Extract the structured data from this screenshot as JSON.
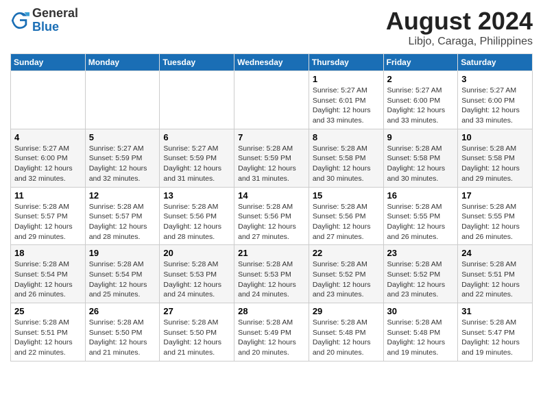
{
  "header": {
    "logo": {
      "general": "General",
      "blue": "Blue"
    },
    "title": "August 2024",
    "subtitle": "Libjo, Caraga, Philippines"
  },
  "calendar": {
    "days_of_week": [
      "Sunday",
      "Monday",
      "Tuesday",
      "Wednesday",
      "Thursday",
      "Friday",
      "Saturday"
    ],
    "weeks": [
      {
        "days": [
          {
            "number": "",
            "info": ""
          },
          {
            "number": "",
            "info": ""
          },
          {
            "number": "",
            "info": ""
          },
          {
            "number": "",
            "info": ""
          },
          {
            "number": "1",
            "info": "Sunrise: 5:27 AM\nSunset: 6:01 PM\nDaylight: 12 hours\nand 33 minutes."
          },
          {
            "number": "2",
            "info": "Sunrise: 5:27 AM\nSunset: 6:00 PM\nDaylight: 12 hours\nand 33 minutes."
          },
          {
            "number": "3",
            "info": "Sunrise: 5:27 AM\nSunset: 6:00 PM\nDaylight: 12 hours\nand 33 minutes."
          }
        ]
      },
      {
        "days": [
          {
            "number": "4",
            "info": "Sunrise: 5:27 AM\nSunset: 6:00 PM\nDaylight: 12 hours\nand 32 minutes."
          },
          {
            "number": "5",
            "info": "Sunrise: 5:27 AM\nSunset: 5:59 PM\nDaylight: 12 hours\nand 32 minutes."
          },
          {
            "number": "6",
            "info": "Sunrise: 5:27 AM\nSunset: 5:59 PM\nDaylight: 12 hours\nand 31 minutes."
          },
          {
            "number": "7",
            "info": "Sunrise: 5:28 AM\nSunset: 5:59 PM\nDaylight: 12 hours\nand 31 minutes."
          },
          {
            "number": "8",
            "info": "Sunrise: 5:28 AM\nSunset: 5:58 PM\nDaylight: 12 hours\nand 30 minutes."
          },
          {
            "number": "9",
            "info": "Sunrise: 5:28 AM\nSunset: 5:58 PM\nDaylight: 12 hours\nand 30 minutes."
          },
          {
            "number": "10",
            "info": "Sunrise: 5:28 AM\nSunset: 5:58 PM\nDaylight: 12 hours\nand 29 minutes."
          }
        ]
      },
      {
        "days": [
          {
            "number": "11",
            "info": "Sunrise: 5:28 AM\nSunset: 5:57 PM\nDaylight: 12 hours\nand 29 minutes."
          },
          {
            "number": "12",
            "info": "Sunrise: 5:28 AM\nSunset: 5:57 PM\nDaylight: 12 hours\nand 28 minutes."
          },
          {
            "number": "13",
            "info": "Sunrise: 5:28 AM\nSunset: 5:56 PM\nDaylight: 12 hours\nand 28 minutes."
          },
          {
            "number": "14",
            "info": "Sunrise: 5:28 AM\nSunset: 5:56 PM\nDaylight: 12 hours\nand 27 minutes."
          },
          {
            "number": "15",
            "info": "Sunrise: 5:28 AM\nSunset: 5:56 PM\nDaylight: 12 hours\nand 27 minutes."
          },
          {
            "number": "16",
            "info": "Sunrise: 5:28 AM\nSunset: 5:55 PM\nDaylight: 12 hours\nand 26 minutes."
          },
          {
            "number": "17",
            "info": "Sunrise: 5:28 AM\nSunset: 5:55 PM\nDaylight: 12 hours\nand 26 minutes."
          }
        ]
      },
      {
        "days": [
          {
            "number": "18",
            "info": "Sunrise: 5:28 AM\nSunset: 5:54 PM\nDaylight: 12 hours\nand 26 minutes."
          },
          {
            "number": "19",
            "info": "Sunrise: 5:28 AM\nSunset: 5:54 PM\nDaylight: 12 hours\nand 25 minutes."
          },
          {
            "number": "20",
            "info": "Sunrise: 5:28 AM\nSunset: 5:53 PM\nDaylight: 12 hours\nand 24 minutes."
          },
          {
            "number": "21",
            "info": "Sunrise: 5:28 AM\nSunset: 5:53 PM\nDaylight: 12 hours\nand 24 minutes."
          },
          {
            "number": "22",
            "info": "Sunrise: 5:28 AM\nSunset: 5:52 PM\nDaylight: 12 hours\nand 23 minutes."
          },
          {
            "number": "23",
            "info": "Sunrise: 5:28 AM\nSunset: 5:52 PM\nDaylight: 12 hours\nand 23 minutes."
          },
          {
            "number": "24",
            "info": "Sunrise: 5:28 AM\nSunset: 5:51 PM\nDaylight: 12 hours\nand 22 minutes."
          }
        ]
      },
      {
        "days": [
          {
            "number": "25",
            "info": "Sunrise: 5:28 AM\nSunset: 5:51 PM\nDaylight: 12 hours\nand 22 minutes."
          },
          {
            "number": "26",
            "info": "Sunrise: 5:28 AM\nSunset: 5:50 PM\nDaylight: 12 hours\nand 21 minutes."
          },
          {
            "number": "27",
            "info": "Sunrise: 5:28 AM\nSunset: 5:50 PM\nDaylight: 12 hours\nand 21 minutes."
          },
          {
            "number": "28",
            "info": "Sunrise: 5:28 AM\nSunset: 5:49 PM\nDaylight: 12 hours\nand 20 minutes."
          },
          {
            "number": "29",
            "info": "Sunrise: 5:28 AM\nSunset: 5:48 PM\nDaylight: 12 hours\nand 20 minutes."
          },
          {
            "number": "30",
            "info": "Sunrise: 5:28 AM\nSunset: 5:48 PM\nDaylight: 12 hours\nand 19 minutes."
          },
          {
            "number": "31",
            "info": "Sunrise: 5:28 AM\nSunset: 5:47 PM\nDaylight: 12 hours\nand 19 minutes."
          }
        ]
      }
    ]
  }
}
